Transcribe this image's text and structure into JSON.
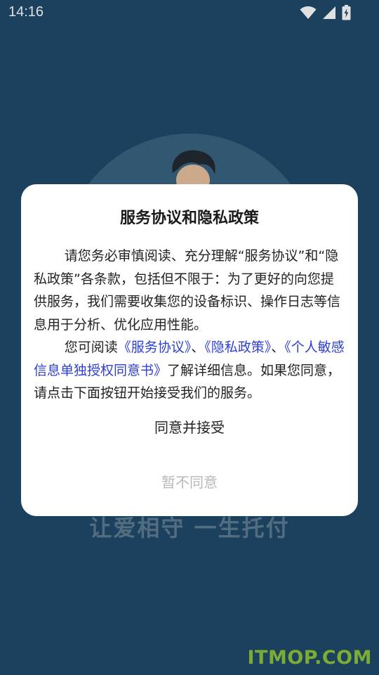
{
  "status_bar": {
    "time": "14:16",
    "icons": [
      "wifi-icon",
      "signal-icon",
      "battery-charging-icon"
    ]
  },
  "background": {
    "slogan": "让爱相守  一生托付",
    "watermark": "ITMOP.COM"
  },
  "dialog": {
    "title": "服务协议和隐私政策",
    "paragraph1": "请您务必审慎阅读、充分理解“服务协议”和“隐私政策”各条款，包括但不限于：为了更好的向您提供服务，我们需要收集您的设备标识、操作日志等信息用于分析、优化应用性能。",
    "paragraph2_prefix": "您可阅读",
    "link_service": "《服务协议》",
    "sep1": "、",
    "link_privacy": "《隐私政策》",
    "sep2": "、",
    "link_sensitive": "《个人敏感信息单独授权同意书》",
    "paragraph2_suffix": "了解详细信息。如果您同意，请点击下面按钮开始接受我们的服务。",
    "accept_label": "同意并接受",
    "decline_label": "暂不同意"
  },
  "colors": {
    "background": "#1f4a6b",
    "link": "#2e3fd8",
    "watermark": "#8fc43c",
    "decline_text": "#b8b8b8"
  }
}
